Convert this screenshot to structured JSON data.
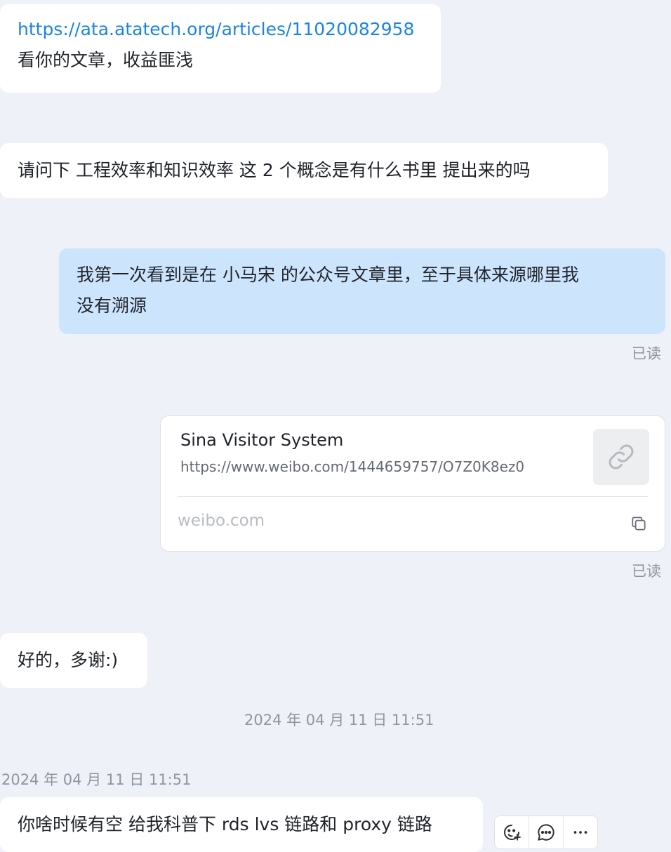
{
  "messages": [
    {
      "link": "https://ata.atatech.org/articles/11020082958",
      "text": "看你的文章，收益匪浅"
    },
    {
      "text": "请问下 工程效率和知识效率 这 2 个概念是有什么书里 提出来的吗"
    },
    {
      "line1": "我第一次看到是在 小马宋 的公众号文章里，至于具体来源哪里我",
      "line2": "没有溯源",
      "status": "已读"
    },
    {
      "card": {
        "title": "Sina Visitor System",
        "url": "https://www.weibo.com/1444659757/O7Z0K8ez0",
        "domain": "weibo.com",
        "thumb_icon": "link-icon",
        "copy_icon": "copy-icon"
      },
      "status": "已读"
    },
    {
      "text": "好的，多谢:)"
    },
    {
      "time_divider": "2024 年 04 月 11 日  11:51"
    },
    {
      "sender_time": "2024 年 04 月 11 日  11:51",
      "text": "你啥时候有空 给我科普下 rds lvs 链路和 proxy 链路"
    }
  ],
  "actions": [
    {
      "icon": "add-reaction-icon"
    },
    {
      "icon": "reply-icon"
    },
    {
      "icon": "more-icon"
    }
  ],
  "colors": {
    "background": "#eff1f8",
    "incoming_bubble": "#ffffff",
    "outgoing_bubble": "#cce5fd",
    "link": "#1a84e6",
    "secondary_text": "#8f959e"
  }
}
